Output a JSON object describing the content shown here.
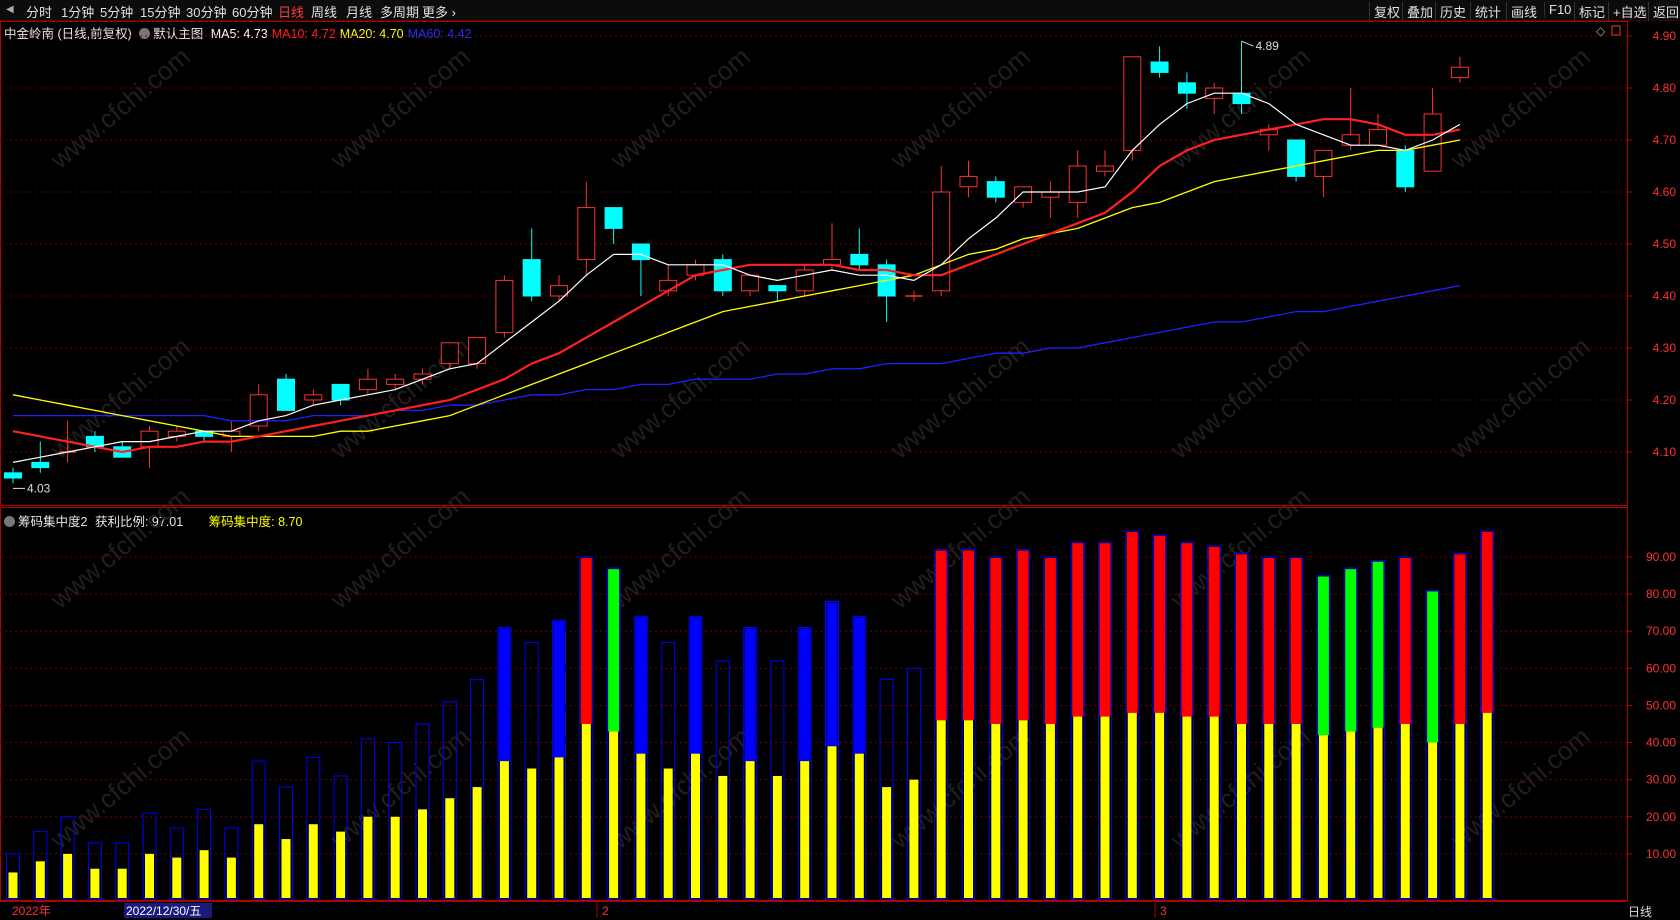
{
  "toolbar": {
    "periods": [
      "分时",
      "1分钟",
      "5分钟",
      "15分钟",
      "30分钟",
      "60分钟",
      "日线",
      "周线",
      "月线",
      "多周期",
      "更多 ›"
    ],
    "active_period": "日线",
    "tools": [
      "复权",
      "叠加",
      "历史",
      "统计",
      "画线",
      "F10",
      "标记",
      "+自选",
      "返回"
    ]
  },
  "main_legend": {
    "title": "中金岭南 (日线,前复权)",
    "template": "默认主图",
    "ma": [
      {
        "label": "MA5: 4.73",
        "color": "#ffffff"
      },
      {
        "label": "MA10: 4.72",
        "color": "#ff2020"
      },
      {
        "label": "MA20: 4.70",
        "color": "#ffff00"
      },
      {
        "label": "MA60: 4.42",
        "color": "#2a2aff"
      }
    ]
  },
  "sub_legend": {
    "indicator": "筹码集中度2",
    "profit_ratio": "获利比例: 97.01",
    "concentration": "筹码集中度: 8.70"
  },
  "bottom": {
    "period_tag": "日线",
    "date_labels": [
      "2022年",
      "2022/12/30/五",
      "2",
      "3"
    ]
  },
  "watermark": "www.cfchi.com",
  "colors": {
    "up": "#ff3030",
    "down": "#00ffff",
    "ma5": "#ffffff",
    "ma10": "#ff2020",
    "ma20": "#ffff00",
    "ma60": "#2020ff",
    "grid": "#6a0000",
    "axis": "#b00000",
    "bar_yellow": "#ffff00",
    "bar_red": "#ff0000",
    "bar_green": "#00ff00",
    "bar_blue": "#0000ff"
  },
  "chart_data": {
    "type": "candlestick",
    "y_axis_main": {
      "ticks": [
        "4.90",
        "4.80",
        "4.70",
        "4.60",
        "4.50",
        "4.40",
        "4.30",
        "4.20",
        "4.10"
      ],
      "range": [
        4.03,
        4.89
      ]
    },
    "y_axis_sub": {
      "ticks": [
        "90.00",
        "80.00",
        "70.00",
        "60.00",
        "50.00",
        "40.00",
        "30.00",
        "20.00",
        "10.00"
      ],
      "range": [
        0,
        100
      ]
    },
    "annotations": {
      "high": "4.89",
      "low": "4.03"
    },
    "candles": [
      [
        4.06,
        4.07,
        4.05,
        4.04
      ],
      [
        4.08,
        4.12,
        4.07,
        4.06
      ],
      [
        4.1,
        4.16,
        4.1,
        4.08
      ],
      [
        4.13,
        4.14,
        4.11,
        4.1
      ],
      [
        4.11,
        4.12,
        4.09,
        4.1
      ],
      [
        4.11,
        4.15,
        4.14,
        4.07
      ],
      [
        4.13,
        4.15,
        4.14,
        4.12
      ],
      [
        4.14,
        4.14,
        4.13,
        4.12
      ],
      [
        4.13,
        4.16,
        4.14,
        4.1
      ],
      [
        4.15,
        4.23,
        4.21,
        4.14
      ],
      [
        4.24,
        4.25,
        4.18,
        4.18
      ],
      [
        4.2,
        4.22,
        4.21,
        4.19
      ],
      [
        4.23,
        4.23,
        4.2,
        4.19
      ],
      [
        4.22,
        4.26,
        4.24,
        4.21
      ],
      [
        4.23,
        4.25,
        4.24,
        4.22
      ],
      [
        4.24,
        4.26,
        4.25,
        4.23
      ],
      [
        4.27,
        4.3,
        4.31,
        4.26
      ],
      [
        4.27,
        4.3,
        4.32,
        4.26
      ],
      [
        4.33,
        4.44,
        4.43,
        4.32
      ],
      [
        4.47,
        4.53,
        4.4,
        4.39
      ],
      [
        4.4,
        4.44,
        4.42,
        4.39
      ],
      [
        4.47,
        4.62,
        4.57,
        4.44
      ],
      [
        4.57,
        4.57,
        4.53,
        4.5
      ],
      [
        4.5,
        4.5,
        4.47,
        4.4
      ],
      [
        4.41,
        4.46,
        4.43,
        4.4
      ],
      [
        4.44,
        4.47,
        4.46,
        4.43
      ],
      [
        4.47,
        4.48,
        4.41,
        4.4
      ],
      [
        4.41,
        4.44,
        4.44,
        4.4
      ],
      [
        4.42,
        4.42,
        4.41,
        4.39
      ],
      [
        4.41,
        4.46,
        4.45,
        4.4
      ],
      [
        4.46,
        4.54,
        4.47,
        4.45
      ],
      [
        4.48,
        4.53,
        4.46,
        4.45
      ],
      [
        4.46,
        4.47,
        4.4,
        4.35
      ],
      [
        4.4,
        4.41,
        4.4,
        4.39
      ],
      [
        4.41,
        4.65,
        4.6,
        4.4
      ],
      [
        4.61,
        4.66,
        4.63,
        4.59
      ],
      [
        4.62,
        4.63,
        4.59,
        4.58
      ],
      [
        4.58,
        4.61,
        4.61,
        4.57
      ],
      [
        4.59,
        4.62,
        4.6,
        4.55
      ],
      [
        4.58,
        4.68,
        4.65,
        4.55
      ],
      [
        4.64,
        4.68,
        4.65,
        4.63
      ],
      [
        4.68,
        4.81,
        4.86,
        4.66
      ],
      [
        4.85,
        4.88,
        4.83,
        4.82
      ],
      [
        4.81,
        4.83,
        4.79,
        4.76
      ],
      [
        4.78,
        4.81,
        4.8,
        4.75
      ],
      [
        4.79,
        4.89,
        4.77,
        4.75
      ],
      [
        4.71,
        4.73,
        4.72,
        4.68
      ],
      [
        4.7,
        4.7,
        4.63,
        4.62
      ],
      [
        4.63,
        4.68,
        4.68,
        4.59
      ],
      [
        4.69,
        4.8,
        4.71,
        4.68
      ],
      [
        4.69,
        4.75,
        4.72,
        4.69
      ],
      [
        4.68,
        4.69,
        4.61,
        4.6
      ],
      [
        4.64,
        4.8,
        4.75,
        4.64
      ],
      [
        4.82,
        4.86,
        4.84,
        4.81
      ]
    ],
    "ma5": [
      4.08,
      4.09,
      4.1,
      4.11,
      4.12,
      4.12,
      4.13,
      4.14,
      4.14,
      4.16,
      4.17,
      4.19,
      4.2,
      4.21,
      4.22,
      4.24,
      4.26,
      4.27,
      4.31,
      4.35,
      4.39,
      4.44,
      4.48,
      4.48,
      4.46,
      4.46,
      4.46,
      4.44,
      4.43,
      4.44,
      4.45,
      4.44,
      4.44,
      4.43,
      4.46,
      4.51,
      4.55,
      4.6,
      4.6,
      4.6,
      4.61,
      4.68,
      4.73,
      4.77,
      4.79,
      4.79,
      4.77,
      4.73,
      4.71,
      4.69,
      4.69,
      4.68,
      4.7,
      4.73
    ],
    "ma10": [
      4.14,
      4.13,
      4.12,
      4.11,
      4.1,
      4.11,
      4.11,
      4.12,
      4.12,
      4.13,
      4.14,
      4.15,
      4.16,
      4.17,
      4.18,
      4.19,
      4.2,
      4.22,
      4.24,
      4.27,
      4.29,
      4.32,
      4.35,
      4.38,
      4.41,
      4.44,
      4.45,
      4.46,
      4.46,
      4.46,
      4.46,
      4.45,
      4.45,
      4.44,
      4.44,
      4.46,
      4.48,
      4.5,
      4.52,
      4.54,
      4.56,
      4.6,
      4.65,
      4.68,
      4.7,
      4.71,
      4.72,
      4.73,
      4.74,
      4.74,
      4.73,
      4.71,
      4.71,
      4.72
    ],
    "ma20": [
      4.21,
      4.2,
      4.19,
      4.18,
      4.17,
      4.16,
      4.15,
      4.14,
      4.13,
      4.13,
      4.13,
      4.13,
      4.14,
      4.14,
      4.15,
      4.16,
      4.17,
      4.19,
      4.21,
      4.23,
      4.25,
      4.27,
      4.29,
      4.31,
      4.33,
      4.35,
      4.37,
      4.38,
      4.39,
      4.4,
      4.41,
      4.42,
      4.43,
      4.44,
      4.46,
      4.48,
      4.49,
      4.51,
      4.52,
      4.53,
      4.55,
      4.57,
      4.58,
      4.6,
      4.62,
      4.63,
      4.64,
      4.65,
      4.66,
      4.67,
      4.68,
      4.68,
      4.69,
      4.7
    ],
    "ma60": [
      4.17,
      4.17,
      4.17,
      4.17,
      4.17,
      4.17,
      4.17,
      4.17,
      4.16,
      4.16,
      4.16,
      4.17,
      4.17,
      4.17,
      4.18,
      4.18,
      4.19,
      4.19,
      4.2,
      4.21,
      4.21,
      4.22,
      4.22,
      4.23,
      4.23,
      4.24,
      4.24,
      4.24,
      4.25,
      4.25,
      4.26,
      4.26,
      4.27,
      4.27,
      4.27,
      4.28,
      4.29,
      4.29,
      4.3,
      4.3,
      4.31,
      4.32,
      4.33,
      4.34,
      4.35,
      4.35,
      4.36,
      4.37,
      4.37,
      4.38,
      4.39,
      4.4,
      4.41,
      4.42
    ],
    "concentration_bars": [
      [
        5,
        10,
        "none"
      ],
      [
        8,
        16,
        "none"
      ],
      [
        10,
        20,
        "none"
      ],
      [
        6,
        13,
        "none"
      ],
      [
        6,
        13,
        "none"
      ],
      [
        10,
        21,
        "none"
      ],
      [
        9,
        17,
        "none"
      ],
      [
        11,
        22,
        "none"
      ],
      [
        9,
        17,
        "none"
      ],
      [
        18,
        35,
        "none"
      ],
      [
        14,
        28,
        "none"
      ],
      [
        18,
        36,
        "none"
      ],
      [
        16,
        31,
        "none"
      ],
      [
        20,
        41,
        "none"
      ],
      [
        20,
        40,
        "none"
      ],
      [
        22,
        45,
        "none"
      ],
      [
        25,
        51,
        "none"
      ],
      [
        28,
        57,
        "none"
      ],
      [
        35,
        71,
        "blue"
      ],
      [
        33,
        67,
        "none"
      ],
      [
        36,
        73,
        "blue"
      ],
      [
        45,
        90,
        "red"
      ],
      [
        43,
        87,
        "green"
      ],
      [
        37,
        74,
        "blue"
      ],
      [
        33,
        67,
        "none"
      ],
      [
        37,
        74,
        "blue"
      ],
      [
        31,
        62,
        "none"
      ],
      [
        35,
        71,
        "blue"
      ],
      [
        31,
        62,
        "none"
      ],
      [
        35,
        71,
        "blue"
      ],
      [
        39,
        78,
        "blue"
      ],
      [
        37,
        74,
        "blue"
      ],
      [
        28,
        57,
        "none"
      ],
      [
        30,
        60,
        "none"
      ],
      [
        46,
        92,
        "red"
      ],
      [
        46,
        92,
        "red"
      ],
      [
        45,
        90,
        "red"
      ],
      [
        46,
        92,
        "red"
      ],
      [
        45,
        90,
        "red"
      ],
      [
        47,
        94,
        "red"
      ],
      [
        47,
        94,
        "red"
      ],
      [
        48,
        97,
        "red"
      ],
      [
        48,
        96,
        "red"
      ],
      [
        47,
        94,
        "red"
      ],
      [
        47,
        93,
        "red"
      ],
      [
        45,
        91,
        "red"
      ],
      [
        45,
        90,
        "red"
      ],
      [
        45,
        90,
        "red"
      ],
      [
        42,
        85,
        "green"
      ],
      [
        43,
        87,
        "green"
      ],
      [
        44,
        89,
        "green"
      ],
      [
        45,
        90,
        "red"
      ],
      [
        40,
        81,
        "green"
      ],
      [
        45,
        91,
        "red"
      ],
      [
        48,
        97,
        "red"
      ]
    ]
  }
}
